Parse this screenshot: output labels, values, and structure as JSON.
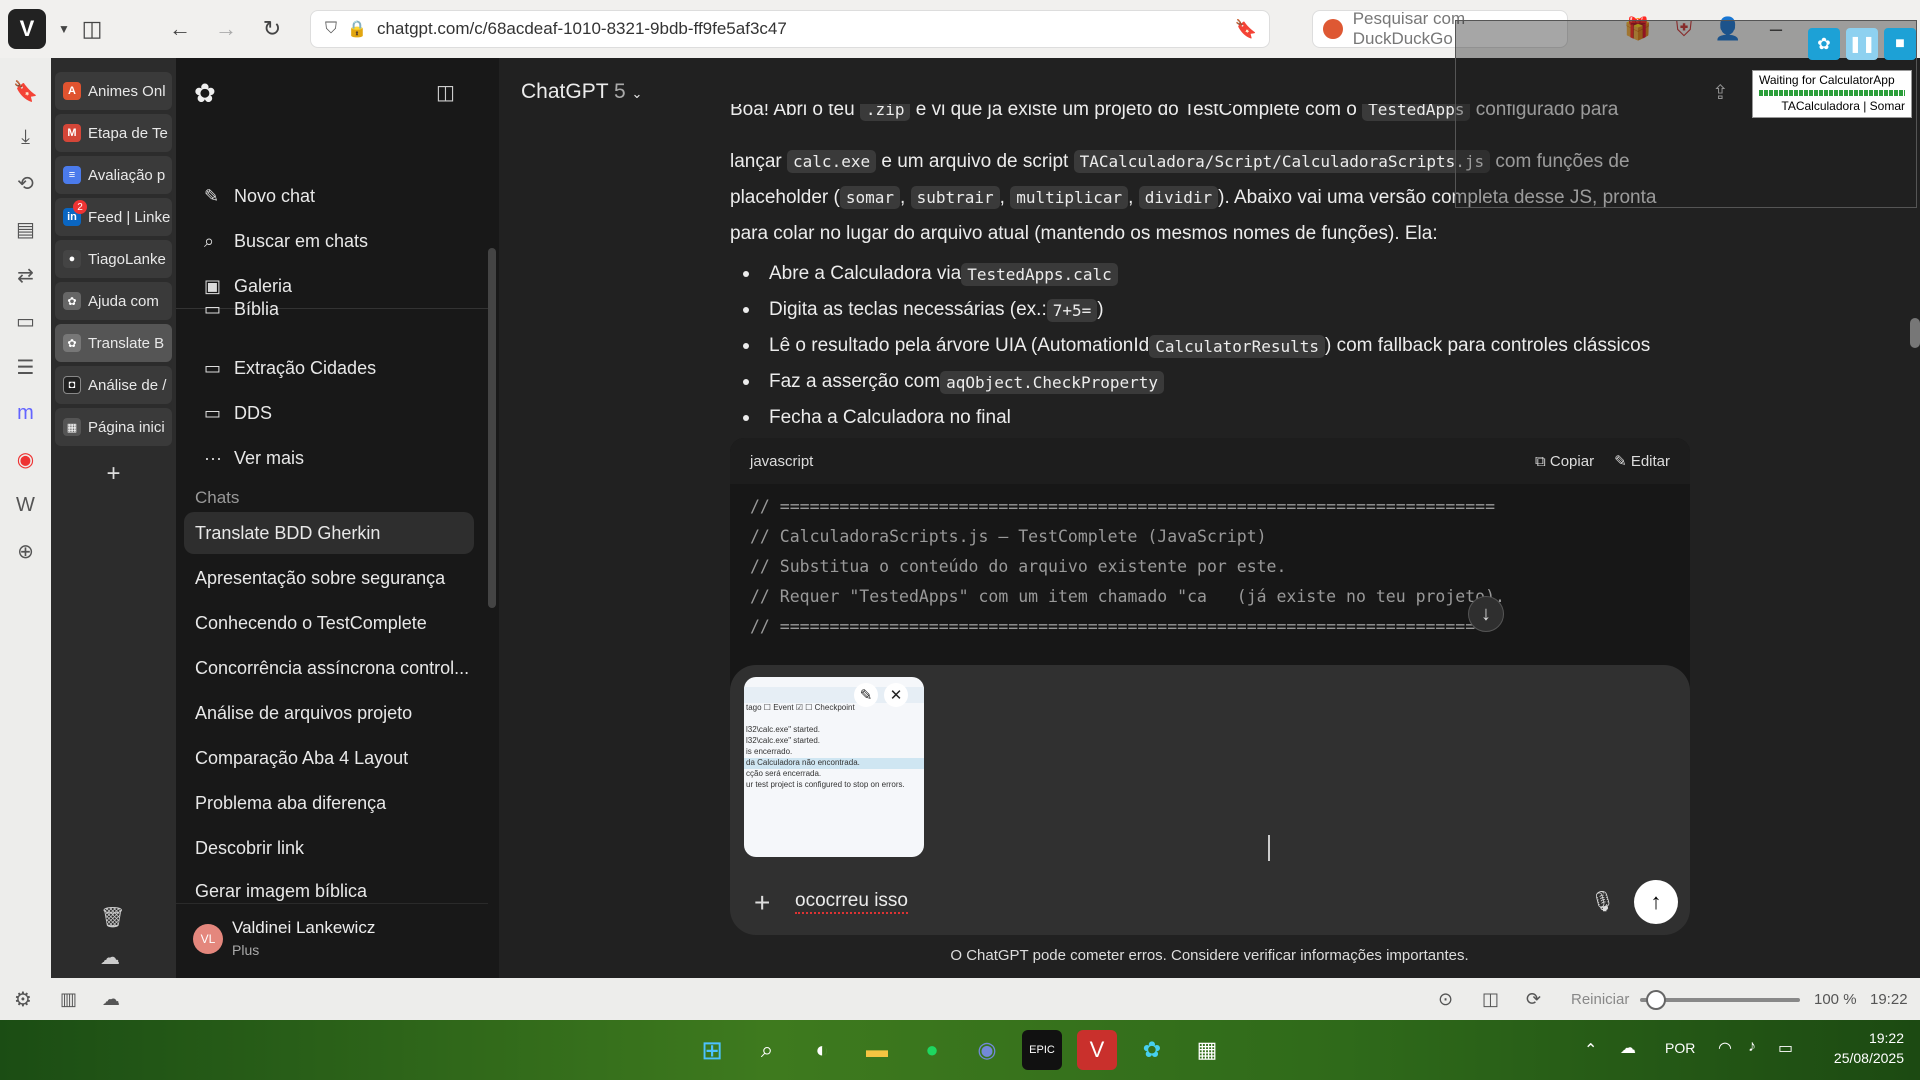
{
  "browser": {
    "url": "chatgpt.com/c/68acdeaf-1010-8321-9bdb-ff9fe5af3c47",
    "search_placeholder": "Pesquisar com DuckDuckGo"
  },
  "tabs": [
    {
      "label": "Animes Onl",
      "color": "#e0532f",
      "glyph": "A"
    },
    {
      "label": "Etapa de Te",
      "color": "#d44638",
      "glyph": "M"
    },
    {
      "label": "Avaliação p",
      "color": "#4b7bec",
      "glyph": "≡"
    },
    {
      "label": "Feed | Linke",
      "color": "#0a66c2",
      "glyph": "in",
      "badge": "2"
    },
    {
      "label": "TiagoLanke",
      "color": "#444",
      "glyph": "●"
    },
    {
      "label": "Ajuda com",
      "color": "#666",
      "glyph": "✿"
    },
    {
      "label": "Translate B",
      "color": "#777",
      "glyph": "✿"
    },
    {
      "label": "Análise de /",
      "color": "#222",
      "glyph": "◘"
    },
    {
      "label": "Página inici",
      "color": "#555",
      "glyph": "▦"
    }
  ],
  "sidebar": {
    "new_chat": "Novo chat",
    "search_chats": "Buscar em chats",
    "gallery": "Galeria",
    "project_partial": "Bíblia",
    "project_1": "Extração Cidades",
    "project_2": "DDS",
    "see_more": "Ver mais",
    "chats_heading": "Chats",
    "chats": [
      "Translate BDD Gherkin",
      "Apresentação sobre segurança",
      "Conhecendo o TestComplete",
      "Concorrência assíncrona control...",
      "Análise de arquivos projeto",
      "Comparação Aba 4 Layout",
      "Problema aba diferença",
      "Descobrir link",
      "Gerar imagem bíblica"
    ],
    "user_initials": "VL",
    "user_name": "Valdinei Lankewicz",
    "user_plan": "Plus"
  },
  "main": {
    "model": "ChatGPT",
    "model_version": "5",
    "p1": {
      "a": "Boa! Abri o teu ",
      "c1": ".zip",
      "b": " e vi que já existe um projeto do TestComplete com o ",
      "c2": "TestedApps",
      "d": " configurado para"
    },
    "p2": {
      "a": "lançar ",
      "c1": "calc.exe",
      "b": " e um arquivo de script ",
      "c2": "TACalculadora/Script/CalculadoraScripts.js",
      "d": " com funções de"
    },
    "p3": {
      "a": "placeholder (",
      "c1": "somar",
      "s1": ", ",
      "c2": "subtrair",
      "s2": ", ",
      "c3": "multiplicar",
      "s3": ", ",
      "c4": "dividir",
      "b": "). Abaixo vai uma versão completa desse JS, pronta"
    },
    "p4": "para colar no lugar do arquivo atual (mantendo os mesmos nomes de funções). Ela:",
    "bullets": {
      "b1a": "Abre a Calculadora via ",
      "b1c": "TestedApps.calc",
      "b2a": "Digita as teclas necessárias (ex.: ",
      "b2c": "7+5=",
      "b2b": ")",
      "b3a": "Lê o resultado pela árvore UIA (AutomationId ",
      "b3c": "CalculatorResults",
      "b3b": ") com fallback para controles clássicos",
      "b4a": "Faz a asserção com ",
      "b4c": "aqObject.CheckProperty",
      "b5": "Fecha a Calculadora no final"
    },
    "code": {
      "lang": "javascript",
      "copy": "Copiar",
      "edit": "Editar",
      "lines": [
        "// ========================================================================",
        "// CalculadoraScripts.js — TestComplete (JavaScript)",
        "// Substitua o conteúdo do arquivo existente por este.",
        "// Requer \"TestedApps\" com um item chamado \"ca   (já existe no teu projeto).",
        "// ========================================================================"
      ]
    },
    "attachment_rows": [
      "tago   ☐ Event  ☑ ☐ Checkpoint",
      "",
      "l32\\calc.exe\" started.",
      "l32\\calc.exe\" started.",
      "is encerrado.",
      "da Calculadora não encontrada.",
      "cção será encerrada.",
      "ur test project is configured to stop on errors."
    ],
    "input_value": "ococrreu isso",
    "disclaimer": "O ChatGPT pode cometer erros. Considere verificar informações importantes."
  },
  "overlay": {
    "status": "Waiting for CalculatorApp",
    "context": "TACalculadora | Somar"
  },
  "statusbar": {
    "reset": "Reiniciar",
    "zoom": "100 %",
    "time": "19:22",
    "zoom_level": 0.1
  },
  "taskbar": {
    "lang": "POR",
    "time": "19:22",
    "date": "25/08/2025"
  }
}
